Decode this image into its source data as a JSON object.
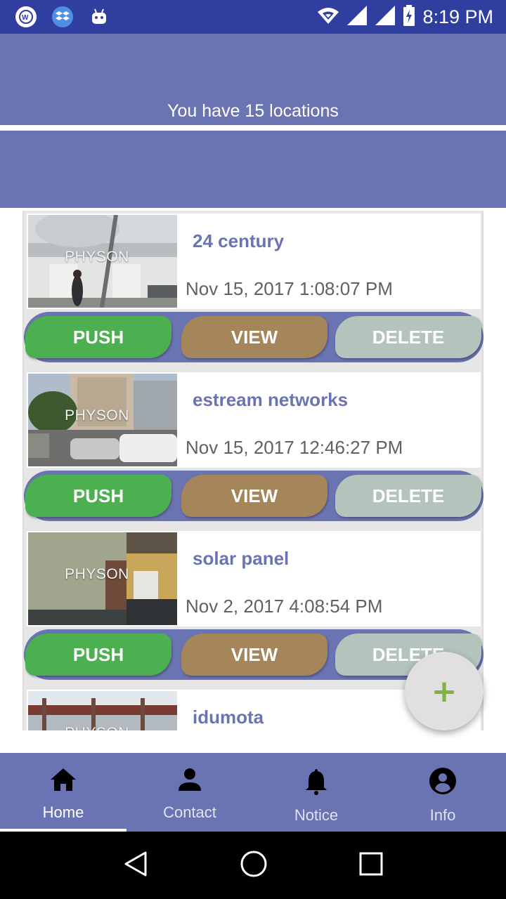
{
  "status_bar": {
    "time": "8:19 PM",
    "icons": [
      "whatsapp-icon",
      "dropbox-icon",
      "android-icon",
      "wifi-icon",
      "signal-icon",
      "signal-icon",
      "battery-icon"
    ]
  },
  "header": {
    "title": "You have 15 locations"
  },
  "locations": [
    {
      "name": "24 century",
      "date": "Nov 15, 2017 1:08:07 PM",
      "thumb_label": "PHYSON"
    },
    {
      "name": "estream networks",
      "date": "Nov 15, 2017 12:46:27 PM",
      "thumb_label": "PHYSON"
    },
    {
      "name": "solar panel",
      "date": "Nov 2, 2017 4:08:54 PM",
      "thumb_label": "PHYSON"
    },
    {
      "name": "idumota",
      "date": "",
      "thumb_label": "PHYSON"
    }
  ],
  "buttons": {
    "push": "PUSH",
    "view": "VIEW",
    "delete": "DELETE"
  },
  "fab": {
    "label": "+"
  },
  "bottom_nav": [
    {
      "label": "Home",
      "icon": "home-icon",
      "active": true
    },
    {
      "label": "Contact",
      "icon": "person-icon",
      "active": false
    },
    {
      "label": "Notice",
      "icon": "bell-icon",
      "active": false
    },
    {
      "label": "Info",
      "icon": "account-circle-icon",
      "active": false
    }
  ],
  "colors": {
    "status_bar": "#303f9f",
    "primary": "#6b74b2",
    "push": "#4caf50",
    "view": "#a5855a",
    "delete": "#b4c3bb",
    "fab_plus": "#7cb342"
  }
}
